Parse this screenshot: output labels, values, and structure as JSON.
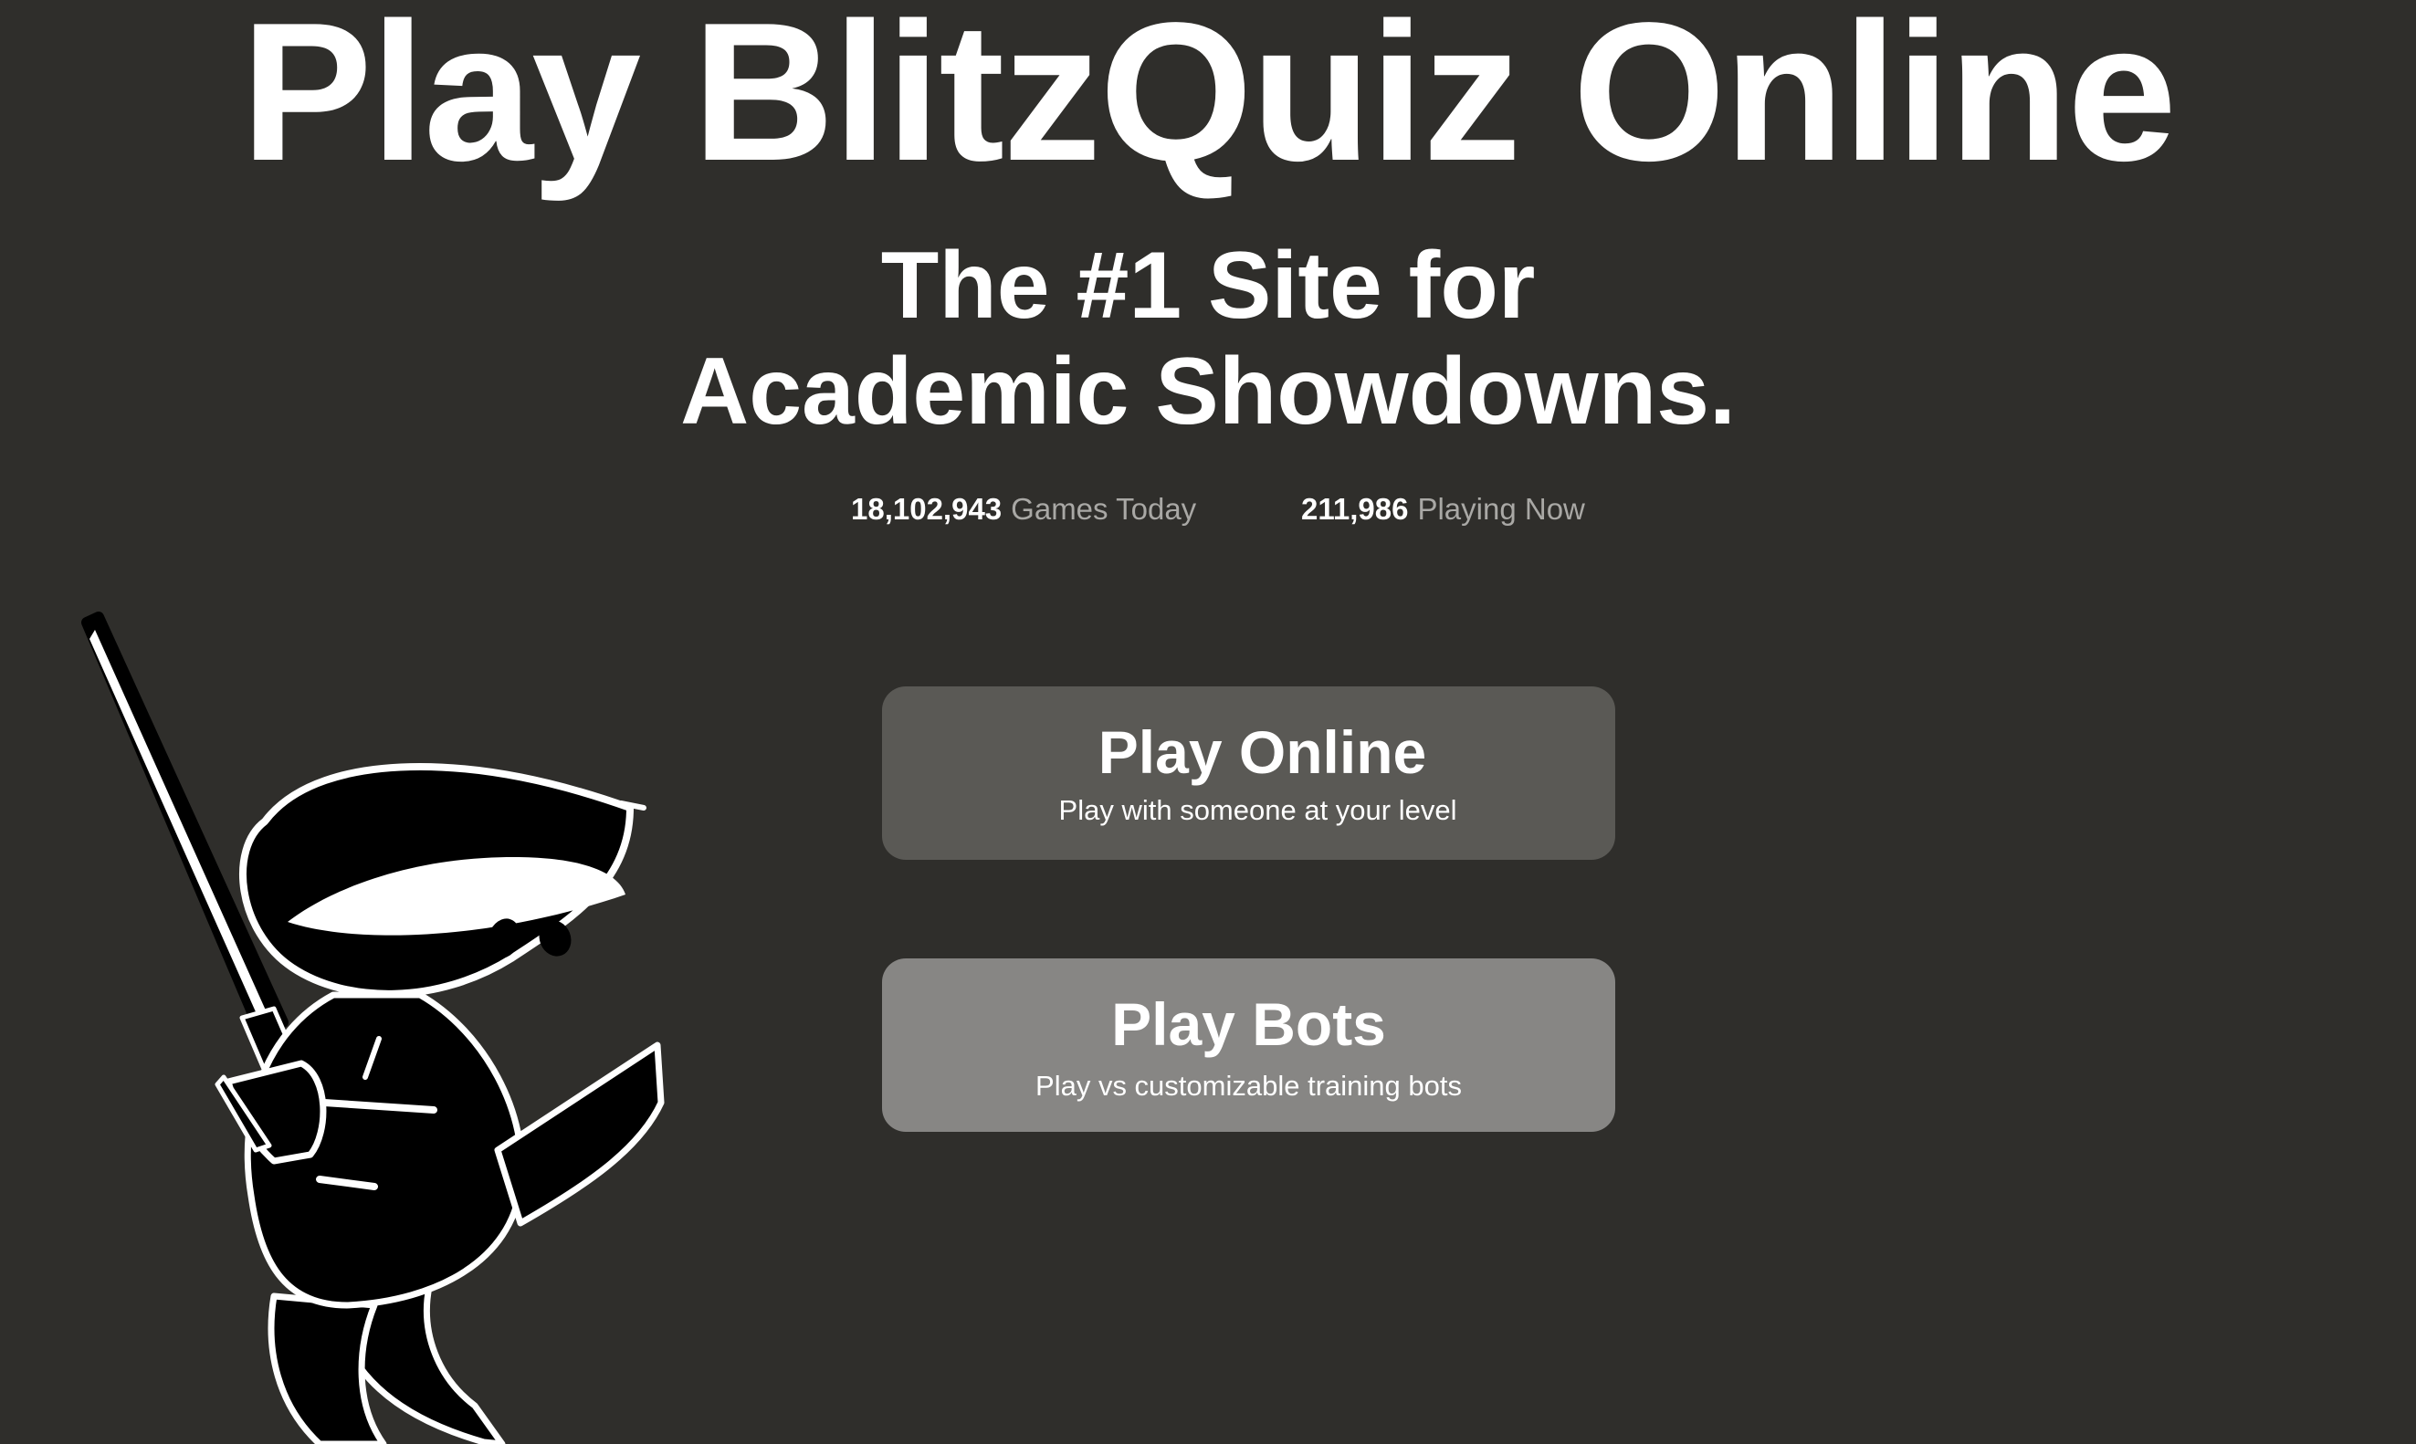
{
  "hero": {
    "title": "Play BlitzQuiz Online",
    "subtitle_line1": "The #1 Site for",
    "subtitle_line2": "Academic Showdowns."
  },
  "stats": {
    "games_today_value": "18,102,943",
    "games_today_label": "Games Today",
    "playing_now_value": "211,986",
    "playing_now_label": "Playing Now"
  },
  "buttons": {
    "online": {
      "title": "Play Online",
      "subtitle": "Play with someone at your level"
    },
    "bots": {
      "title": "Play Bots",
      "subtitle": "Play vs customizable training bots"
    }
  },
  "mascot": {
    "icon": "ninja-mascot-icon"
  },
  "colors": {
    "background": "#2f2e2b",
    "button_online": "#5a5955",
    "button_bots": "#878684",
    "stat_label": "#a9a8a5"
  }
}
